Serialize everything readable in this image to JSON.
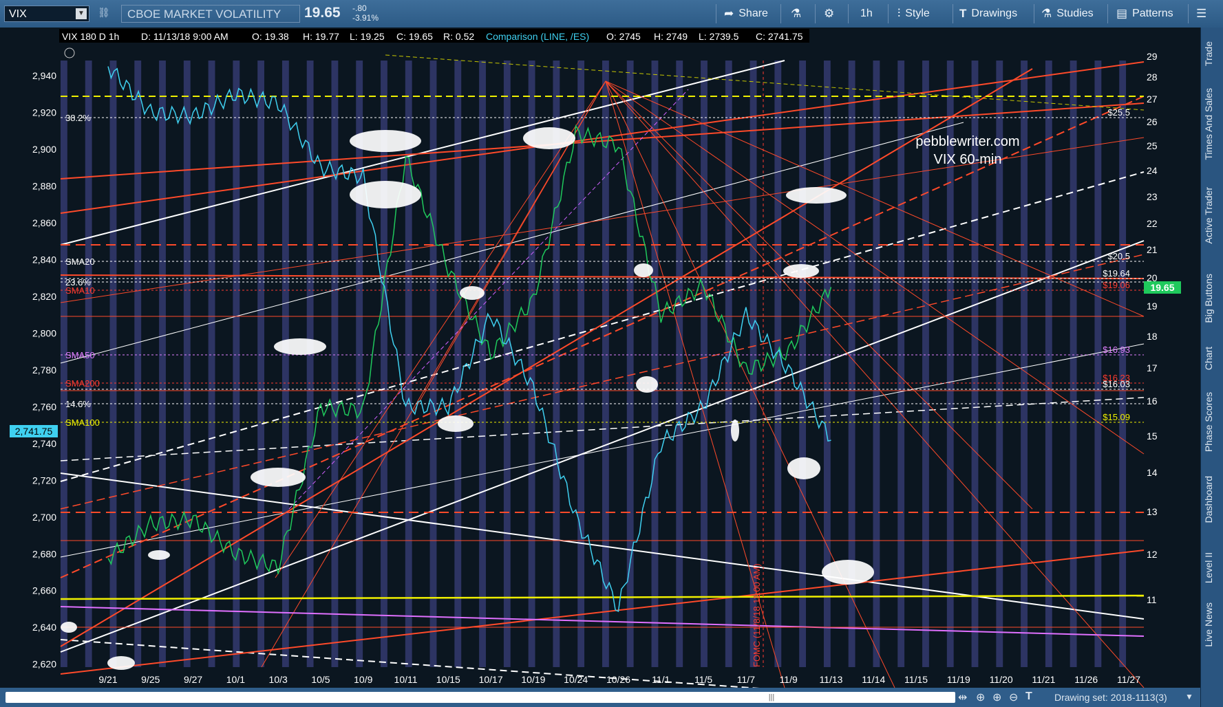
{
  "toolbar": {
    "symbol": "VIX",
    "index_name": "CBOE MARKET VOLATILITY INDEX",
    "price": "19.65",
    "change": "-.80",
    "change_pct": "-3.91%",
    "share": "Share",
    "interval": "1h",
    "style": "Style",
    "drawings": "Drawings",
    "studies": "Studies",
    "patterns": "Patterns"
  },
  "side_tabs": [
    "Trade",
    "Times And Sales",
    "Active Trader",
    "Big Buttons",
    "Chart",
    "Phase Scores",
    "Dashboard",
    "Level II",
    "Live News"
  ],
  "header": {
    "study": "VIX 180 D 1h",
    "date": "D: 11/13/18 9:00 AM",
    "o": "O: 19.38",
    "h": "H: 19.77",
    "l": "L: 19.25",
    "c": "C: 19.65",
    "r": "R: 0.52",
    "comparison": "Comparison (LINE, /ES)",
    "co": "O: 2745",
    "ch": "H: 2749",
    "cl": "L: 2739.5",
    "cc": "C: 2741.75"
  },
  "watermark": {
    "line1": "pebblewriter.com",
    "line2": "VIX 60-min"
  },
  "fomc_label": "FOMC (11/8/18 11:00 AM)",
  "bottom": {
    "drawing_set": "Drawing set: 2018-1113(3)"
  },
  "chart_data": {
    "type": "line",
    "x_ticks": [
      "9/21",
      "9/25",
      "9/27",
      "10/1",
      "10/3",
      "10/5",
      "10/9",
      "10/11",
      "10/15",
      "10/17",
      "10/19",
      "10/24",
      "10/26",
      "11/1",
      "11/5",
      "11/7",
      "11/9",
      "11/13",
      "11/14",
      "11/15",
      "11/19",
      "11/20",
      "11/21",
      "11/26",
      "11/27"
    ],
    "left_axis": {
      "label": "/ES",
      "ylim": [
        2620,
        2960
      ],
      "ticks": [
        "2,940",
        "2,920",
        "2,900",
        "2,880",
        "2,860",
        "2,840",
        "2,820",
        "2,800",
        "2,780",
        "2,760",
        "2,740",
        "2,720",
        "2,700",
        "2,680",
        "2,660",
        "2,640",
        "2,620"
      ]
    },
    "right_axis": {
      "label": "VIX",
      "ticks": [
        "29",
        "28",
        "27",
        "26",
        "25",
        "24",
        "23",
        "22",
        "21",
        "20",
        "19",
        "18",
        "17",
        "16",
        "15",
        "14",
        "13",
        "12",
        "11"
      ]
    },
    "last_values": {
      "vix": "19.65",
      "es": "2,741.75"
    },
    "levels": [
      {
        "name": "SMA20",
        "right": "$20.5",
        "color": "#ffffff"
      },
      {
        "name": "SMA10",
        "right": "$19.06",
        "color": "#ff3b30"
      },
      {
        "name": "",
        "right": "$19.64",
        "color": "#ffffff"
      },
      {
        "name": "SMA50",
        "right": "$16.93",
        "color": "#e080ff"
      },
      {
        "name": "SMA200",
        "right": "$16.23",
        "color": "#ff3b30"
      },
      {
        "name": "",
        "right": "$16.03",
        "color": "#ffffff"
      },
      {
        "name": "SMA100",
        "right": "$15.09",
        "color": "#f0f000"
      },
      {
        "name": "38.2%",
        "right": "$25.5",
        "color": "#ffffff"
      },
      {
        "name": "23.6%",
        "right": "",
        "color": "#ffffff"
      },
      {
        "name": "14.6%",
        "right": "",
        "color": "#ffffff"
      }
    ],
    "series": [
      {
        "name": "VIX",
        "color": "#1fc95c",
        "x": [
          "9/21",
          "9/25",
          "9/27",
          "10/1",
          "10/3",
          "10/5",
          "10/9",
          "10/11",
          "10/15",
          "10/17",
          "10/19",
          "10/24",
          "10/26",
          "11/1",
          "11/5",
          "11/7",
          "11/9",
          "11/13"
        ],
        "values": [
          11.9,
          12.7,
          12.8,
          12.0,
          11.7,
          15.8,
          15.7,
          24.5,
          20.3,
          17.4,
          19.2,
          25.5,
          25.0,
          18.7,
          19.7,
          16.9,
          17.5,
          19.65
        ]
      },
      {
        "name": "/ES",
        "color": "#3fd0f0",
        "x": [
          "9/21",
          "9/25",
          "9/27",
          "10/1",
          "10/3",
          "10/5",
          "10/9",
          "10/11",
          "10/15",
          "10/17",
          "10/19",
          "10/24",
          "10/26",
          "11/1",
          "11/5",
          "11/7",
          "11/9",
          "11/13"
        ],
        "values": [
          2945,
          2920,
          2918,
          2930,
          2925,
          2890,
          2885,
          2760,
          2760,
          2810,
          2770,
          2700,
          2650,
          2740,
          2760,
          2810,
          2780,
          2741.75
        ]
      }
    ],
    "grid": false,
    "colors": {
      "background": "#0b1620",
      "band": "#3a3f7a",
      "price_tag": "#1fc95c",
      "es_tag": "#3fd0f0"
    }
  }
}
